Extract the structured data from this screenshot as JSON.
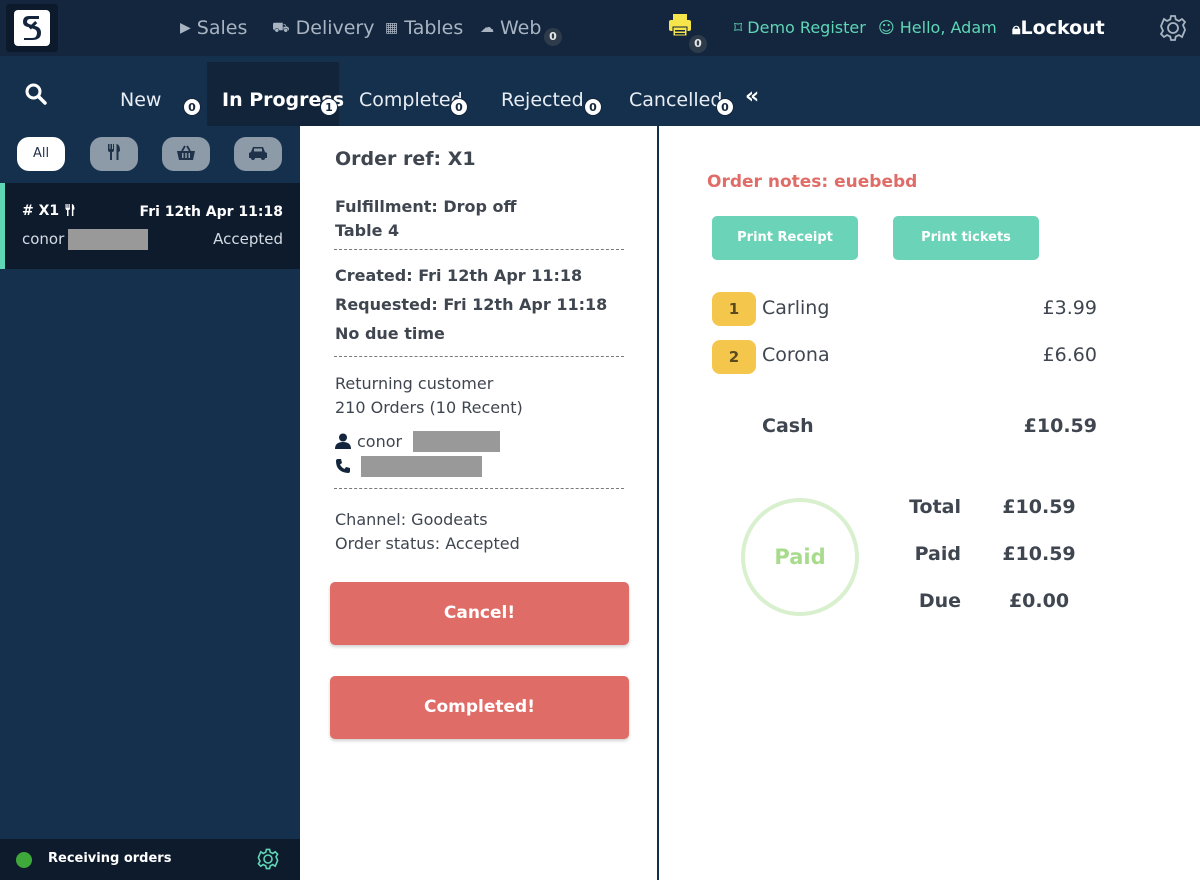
{
  "topbar": {
    "nav": [
      {
        "label": "Sales",
        "icon": "play-icon"
      },
      {
        "label": "Delivery",
        "icon": "scooter-icon"
      },
      {
        "label": "Tables",
        "icon": "grid-icon"
      },
      {
        "label": "Web",
        "icon": "cloud-icon",
        "badge": "0"
      }
    ],
    "printer_badge": "0",
    "register": "Demo Register",
    "hello": "Hello, Adam",
    "lockout": "Lockout"
  },
  "tabs": [
    {
      "label": "New",
      "badge": "0"
    },
    {
      "label": "In Progress",
      "badge": "1"
    },
    {
      "label": "Completed",
      "badge": "0"
    },
    {
      "label": "Rejected",
      "badge": "0"
    },
    {
      "label": "Cancelled",
      "badge": "0"
    }
  ],
  "collapse": "«",
  "filters": {
    "all": "All"
  },
  "order_card": {
    "id": "# X1",
    "date": "Fri 12th Apr 11:18",
    "name": "conor",
    "status": "Accepted"
  },
  "sidebar_footer": {
    "status": "Receiving orders"
  },
  "details": {
    "title": "Order ref: X1",
    "fulfillment": "Fulfillment: Drop off",
    "table": "Table 4",
    "created": "Created: Fri 12th Apr 11:18",
    "requested": "Requested: Fri 12th Apr 11:18",
    "due": "No due time",
    "customer_type": "Returning customer",
    "orders": "210 Orders (10 Recent)",
    "customer_name": "conor",
    "channel": "Channel: Goodeats",
    "order_status": "Order status: Accepted",
    "cancel_label": "Cancel!",
    "completed_label": "Completed!"
  },
  "right": {
    "notes": "Order notes: euebebd",
    "print_receipt": "Print Receipt",
    "print_tickets": "Print tickets",
    "items": [
      {
        "qty": "1",
        "name": "Carling",
        "price": "£3.99"
      },
      {
        "qty": "2",
        "name": "Corona",
        "price": "£6.60"
      }
    ],
    "payment_method": "Cash",
    "payment_amount": "£10.59",
    "paid_stamp": "Paid",
    "summary": [
      {
        "label": "Total",
        "value": "£10.59"
      },
      {
        "label": "Paid",
        "value": "£10.59"
      },
      {
        "label": "Due",
        "value": "£0.00"
      }
    ]
  },
  "colors": {
    "navy": "#15304d",
    "teal": "#5fd6b6",
    "red": "#e06c67",
    "qty_yellow": "#f5c64c",
    "online_green": "#3ea83a"
  }
}
